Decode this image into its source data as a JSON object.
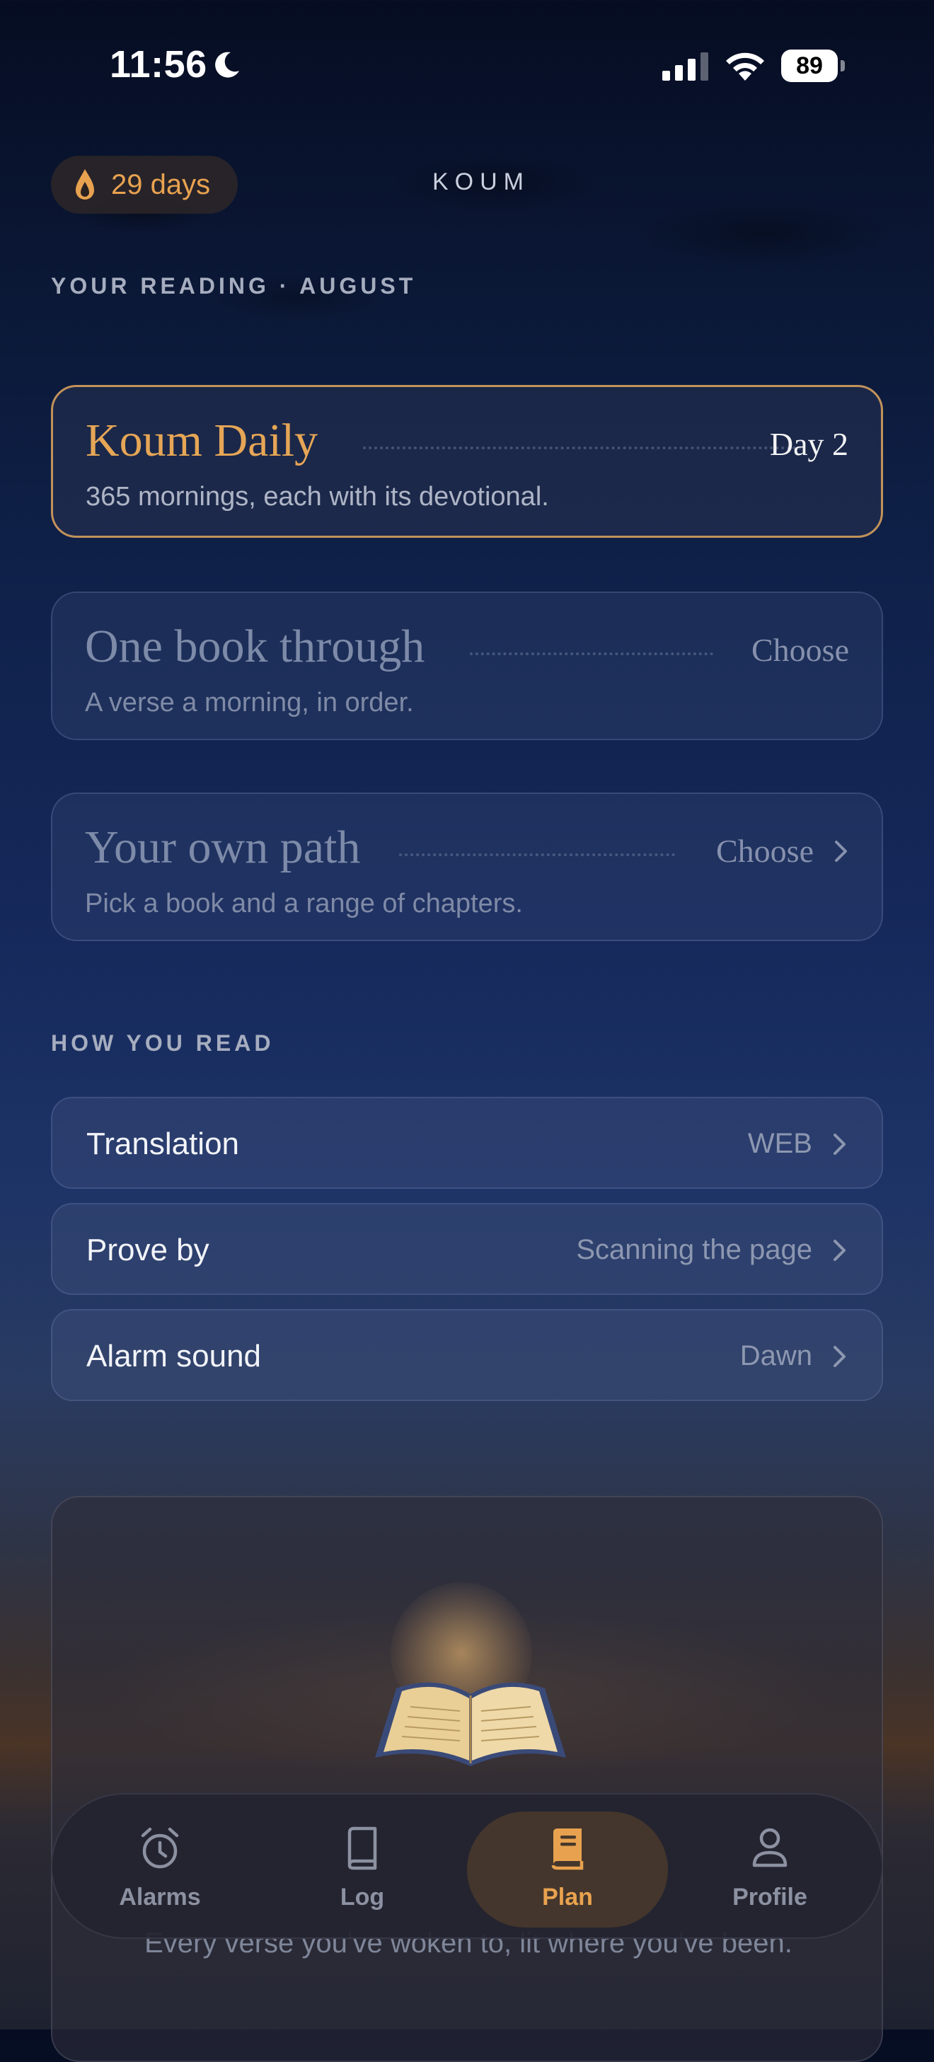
{
  "status_bar": {
    "time": "11:56",
    "battery": "89"
  },
  "header": {
    "streak": "29 days",
    "app_title": "KOUM"
  },
  "reading_section": {
    "label": "YOUR READING · AUGUST",
    "plans": [
      {
        "name": "Koum Daily",
        "status": "Day 2",
        "description": "365 mornings, each with its devotional.",
        "active": true
      },
      {
        "name": "One book through",
        "status": "Choose",
        "description": "A verse a morning, in order.",
        "active": false
      },
      {
        "name": "Your own path",
        "status": "Choose",
        "description": "Pick a book and a range of chapters.",
        "active": false
      }
    ]
  },
  "read_section": {
    "label": "HOW YOU READ",
    "settings": [
      {
        "label": "Translation",
        "value": "WEB"
      },
      {
        "label": "Prove by",
        "value": "Scanning the page"
      },
      {
        "label": "Alarm sound",
        "value": "Dawn"
      }
    ]
  },
  "journey": {
    "caption": "Every verse you've woken to, lit where you've been."
  },
  "tab_bar": {
    "tabs": [
      {
        "label": "Alarms",
        "icon": "alarm-clock-icon"
      },
      {
        "label": "Log",
        "icon": "book-icon"
      },
      {
        "label": "Plan",
        "icon": "book-filled-icon",
        "selected": true
      },
      {
        "label": "Profile",
        "icon": "person-icon"
      }
    ]
  },
  "colors": {
    "accent": "#e8a24f",
    "active_border": "#c2925a"
  }
}
